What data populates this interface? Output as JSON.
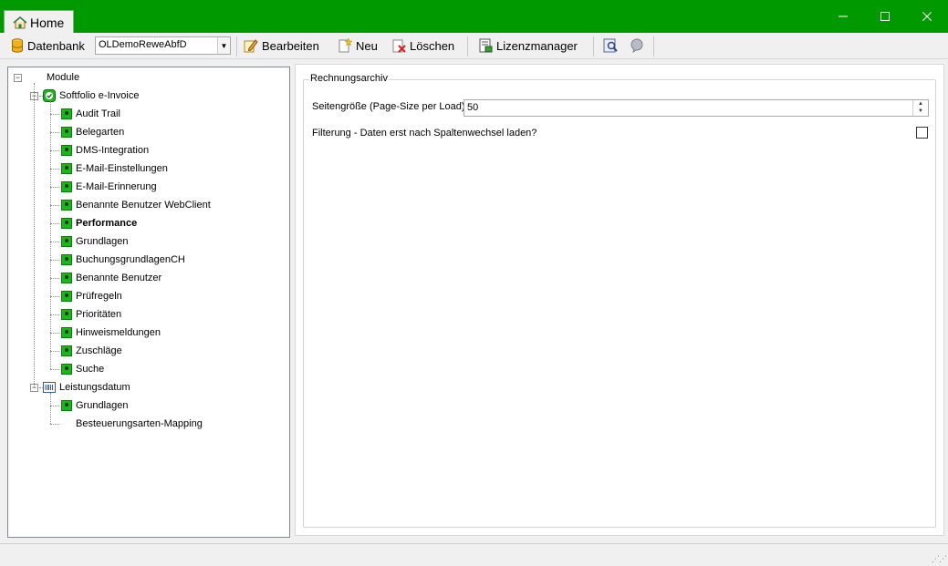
{
  "tab": {
    "label": "Home"
  },
  "window": {
    "minimize": "—",
    "maximize": "☐",
    "close": "✕"
  },
  "toolbar": {
    "datenbank_label": "Datenbank",
    "datenbank_value": "OLDemoReweAbfD",
    "bearbeiten_label": "Bearbeiten",
    "neu_label": "Neu",
    "loeschen_label": "Löschen",
    "lizenzmanager_label": "Lizenzmanager"
  },
  "tree": {
    "root": "Module",
    "group1": {
      "label": "Softfolio e-Invoice",
      "items": [
        "Audit Trail",
        "Belegarten",
        "DMS-Integration",
        "E-Mail-Einstellungen",
        "E-Mail-Erinnerung",
        "Benannte Benutzer WebClient",
        "Performance",
        "Grundlagen",
        "BuchungsgrundlagenCH",
        "Benannte Benutzer",
        "Prüfregeln",
        "Prioritäten",
        "Hinweismeldungen",
        "Zuschläge",
        "Suche"
      ]
    },
    "group2": {
      "label": "Leistungsdatum",
      "items": [
        "Grundlagen",
        "Besteuerungsarten-Mapping"
      ]
    },
    "selected": "Performance"
  },
  "settings": {
    "group_title": "Rechnungsarchiv",
    "page_size_label": "Seitengröße (Page-Size per Load)",
    "page_size_value": "50",
    "filter_label": "Filterung - Daten erst nach Spaltenwechsel laden?",
    "filter_checked": false
  },
  "colors": {
    "titlebar": "#009900",
    "node_icon": "#1db51d"
  }
}
